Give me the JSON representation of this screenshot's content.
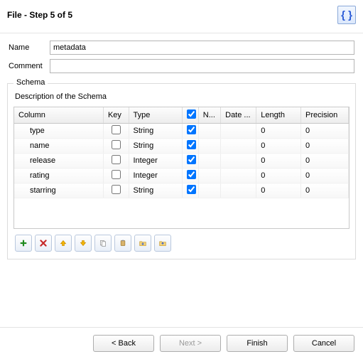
{
  "header": {
    "title": "File - Step 5 of 5"
  },
  "form": {
    "name_label": "Name",
    "name_value": "metadata",
    "comment_label": "Comment",
    "comment_value": ""
  },
  "schema": {
    "group_label": "Schema",
    "description_label": "Description of the Schema",
    "columns": {
      "column": "Column",
      "key": "Key",
      "type": "Type",
      "n": "N...",
      "date": "Date ...",
      "length": "Length",
      "precision": "Precision"
    },
    "rows": [
      {
        "column": "type",
        "key": false,
        "type": "String",
        "nullable": true,
        "date": "",
        "length": "0",
        "precision": "0"
      },
      {
        "column": "name",
        "key": false,
        "type": "String",
        "nullable": true,
        "date": "",
        "length": "0",
        "precision": "0"
      },
      {
        "column": "release",
        "key": false,
        "type": "Integer",
        "nullable": true,
        "date": "",
        "length": "0",
        "precision": "0"
      },
      {
        "column": "rating",
        "key": false,
        "type": "Integer",
        "nullable": true,
        "date": "",
        "length": "0",
        "precision": "0"
      },
      {
        "column": "starring",
        "key": false,
        "type": "String",
        "nullable": true,
        "date": "",
        "length": "0",
        "precision": "0"
      }
    ],
    "toolbar_icons": [
      "add",
      "delete",
      "up",
      "down",
      "copy",
      "paste",
      "import",
      "export"
    ]
  },
  "buttons": {
    "back": "< Back",
    "next": "Next >",
    "finish": "Finish",
    "cancel": "Cancel"
  }
}
